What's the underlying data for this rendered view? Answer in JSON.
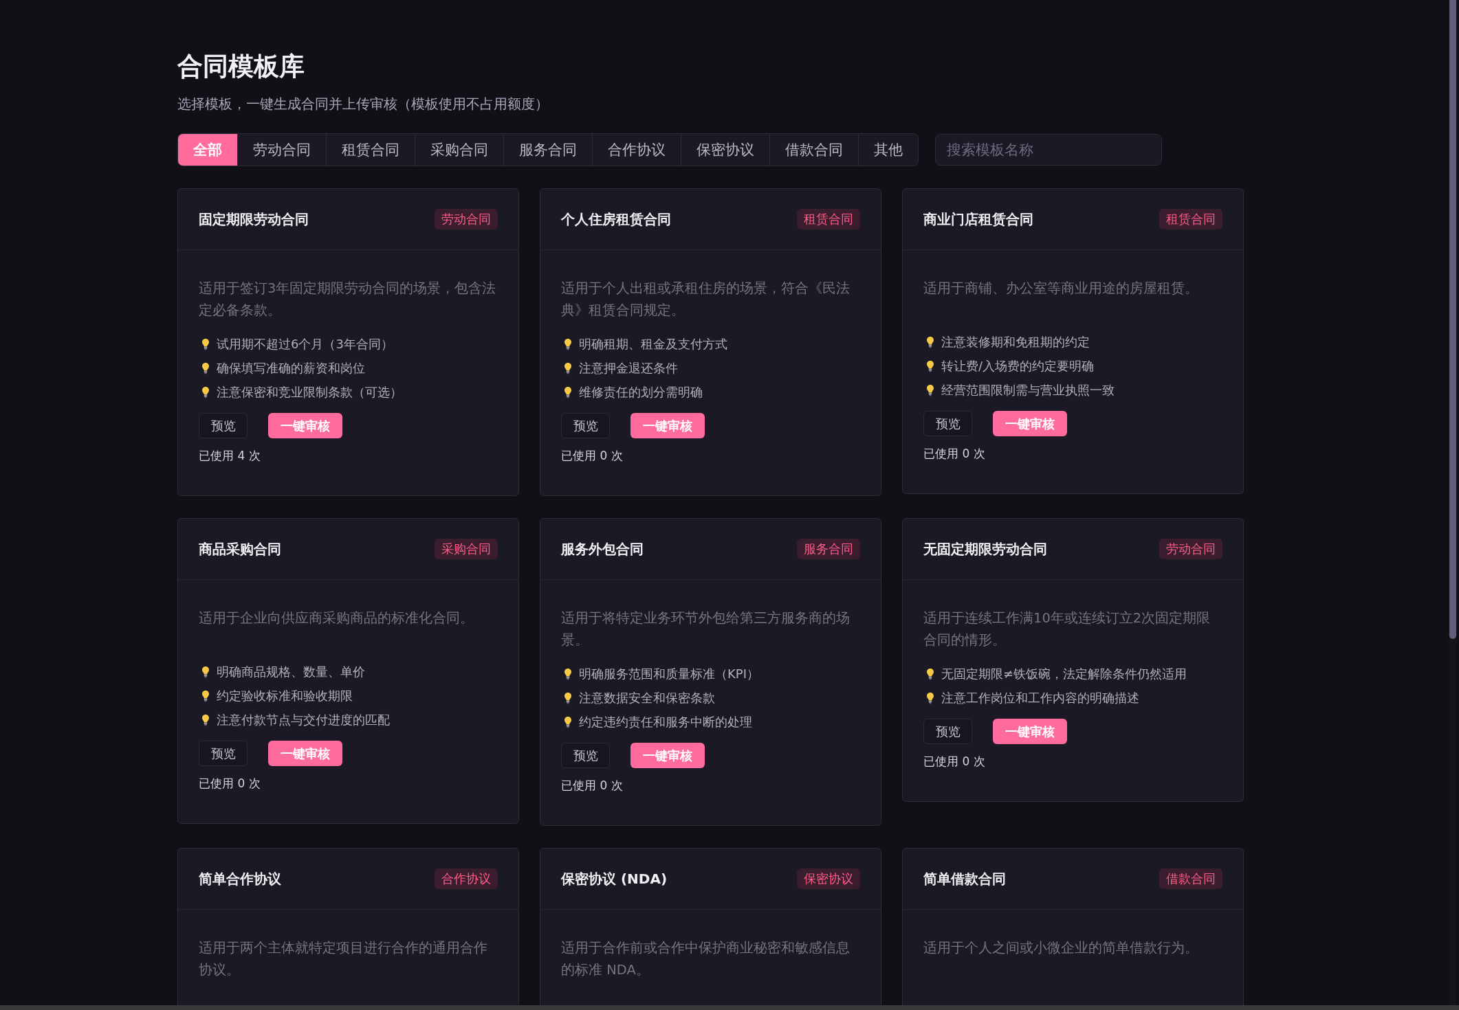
{
  "page": {
    "title": "合同模板库",
    "subtitle": "选择模板，一键生成合同并上传审核（模板使用不占用额度）"
  },
  "tabs": [
    {
      "label": "全部",
      "selected": true
    },
    {
      "label": "劳动合同",
      "selected": false
    },
    {
      "label": "租赁合同",
      "selected": false
    },
    {
      "label": "采购合同",
      "selected": false
    },
    {
      "label": "服务合同",
      "selected": false
    },
    {
      "label": "合作协议",
      "selected": false
    },
    {
      "label": "保密协议",
      "selected": false
    },
    {
      "label": "借款合同",
      "selected": false
    },
    {
      "label": "其他",
      "selected": false
    }
  ],
  "search": {
    "placeholder": "搜索模板名称"
  },
  "templates": [
    {
      "title": "固定期限劳动合同",
      "tag": "劳动合同",
      "description": "适用于签订3年固定期限劳动合同的场景，包含法定必备条款。",
      "tips": [
        "试用期不超过6个月（3年合同）",
        "确保填写准确的薪资和岗位",
        "注意保密和竞业限制条款（可选）"
      ],
      "preview_button": "预览",
      "review_button": "一键审核",
      "usage": "已使用 4 次"
    },
    {
      "title": "个人住房租赁合同",
      "tag": "租赁合同",
      "description": "适用于个人出租或承租住房的场景，符合《民法典》租赁合同规定。",
      "tips": [
        "明确租期、租金及支付方式",
        "注意押金退还条件",
        "维修责任的划分需明确"
      ],
      "preview_button": "预览",
      "review_button": "一键审核",
      "usage": "已使用 0 次"
    },
    {
      "title": "商业门店租赁合同",
      "tag": "租赁合同",
      "description": "适用于商铺、办公室等商业用途的房屋租赁。",
      "tips": [
        "注意装修期和免租期的约定",
        "转让费/入场费的约定要明确",
        "经营范围限制需与营业执照一致"
      ],
      "preview_button": "预览",
      "review_button": "一键审核",
      "usage": "已使用 0 次"
    },
    {
      "title": "商品采购合同",
      "tag": "采购合同",
      "description": "适用于企业向供应商采购商品的标准化合同。",
      "tips": [
        "明确商品规格、数量、单价",
        "约定验收标准和验收期限",
        "注意付款节点与交付进度的匹配"
      ],
      "preview_button": "预览",
      "review_button": "一键审核",
      "usage": "已使用 0 次"
    },
    {
      "title": "服务外包合同",
      "tag": "服务合同",
      "description": "适用于将特定业务环节外包给第三方服务商的场景。",
      "tips": [
        "明确服务范围和质量标准（KPI）",
        "注意数据安全和保密条款",
        "约定违约责任和服务中断的处理"
      ],
      "preview_button": "预览",
      "review_button": "一键审核",
      "usage": "已使用 0 次"
    },
    {
      "title": "无固定期限劳动合同",
      "tag": "劳动合同",
      "description": "适用于连续工作满10年或连续订立2次固定期限合同的情形。",
      "tips": [
        "无固定期限≠铁饭碗，法定解除条件仍然适用",
        "注意工作岗位和工作内容的明确描述"
      ],
      "preview_button": "预览",
      "review_button": "一键审核",
      "usage": "已使用 0 次"
    },
    {
      "title": "简单合作协议",
      "tag": "合作协议",
      "description": "适用于两个主体就特定项目进行合作的通用合作协议。"
    },
    {
      "title": "保密协议 (NDA)",
      "tag": "保密协议",
      "description": "适用于合作前或合作中保护商业秘密和敏感信息的标准 NDA。"
    },
    {
      "title": "简单借款合同",
      "tag": "借款合同",
      "description": "适用于个人之间或小微企业的简单借款行为。"
    }
  ]
}
